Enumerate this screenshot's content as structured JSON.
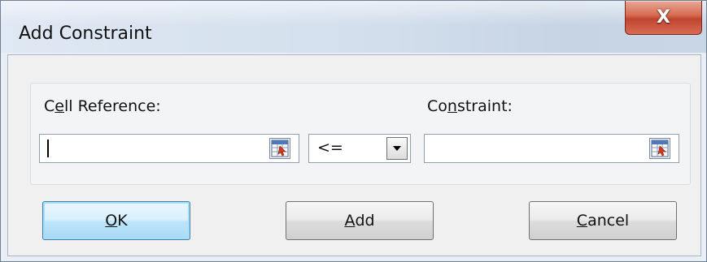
{
  "window": {
    "title": "Add Constraint",
    "close_label": "X"
  },
  "form": {
    "cell_reference": {
      "label_accel": "e",
      "label_pre": "C",
      "label_post": "ll Reference:",
      "value": ""
    },
    "operator": {
      "selected": "<="
    },
    "constraint": {
      "label_pre": "Co",
      "label_accel": "n",
      "label_post": "straint:",
      "value": ""
    }
  },
  "buttons": {
    "ok": {
      "accel": "O",
      "rest": "K"
    },
    "add": {
      "accel": "A",
      "rest": "dd"
    },
    "cancel": {
      "accel": "C",
      "rest": "ancel"
    }
  },
  "icons": {
    "range_picker": "range-select-icon",
    "dropdown": "chevron-down-icon",
    "close": "close-icon"
  }
}
